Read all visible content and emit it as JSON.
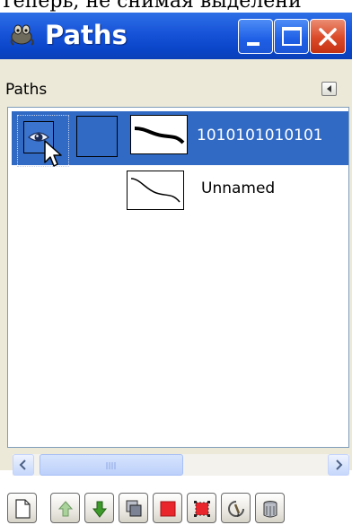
{
  "top_text": "Теперь, не снимая выделени",
  "window": {
    "title": "Paths",
    "buttons": {
      "minimize": "minimize",
      "maximize": "maximize",
      "close": "close"
    }
  },
  "panel": {
    "title": "Paths",
    "menu_icon": "tab-menu-icon"
  },
  "paths": [
    {
      "name": "1010101010101",
      "selected": true,
      "visible": true
    },
    {
      "name": "Unnamed",
      "selected": false,
      "visible": false
    }
  ],
  "toolbar": {
    "icons": [
      "new-path-icon",
      "raise-path-icon",
      "lower-path-icon",
      "duplicate-path-icon",
      "path-to-selection-icon",
      "selection-to-path-icon",
      "paint-along-path-icon",
      "delete-path-icon"
    ]
  },
  "colors": {
    "titlebar": "#1653d8",
    "selection": "#316ac5",
    "close_button": "#db4a28",
    "panel_bg": "#ece9d8"
  }
}
